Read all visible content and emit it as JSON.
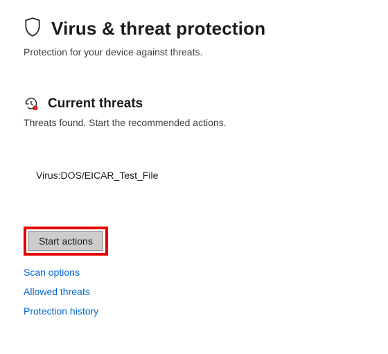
{
  "header": {
    "title": "Virus & threat protection",
    "subtitle": "Protection for your device against threats."
  },
  "section": {
    "title": "Current threats",
    "description": "Threats found. Start the recommended actions."
  },
  "threat": {
    "name": "Virus:DOS/EICAR_Test_File"
  },
  "actions": {
    "start_label": "Start actions"
  },
  "links": {
    "scan_options": "Scan options",
    "allowed_threats": "Allowed threats",
    "protection_history": "Protection history"
  }
}
